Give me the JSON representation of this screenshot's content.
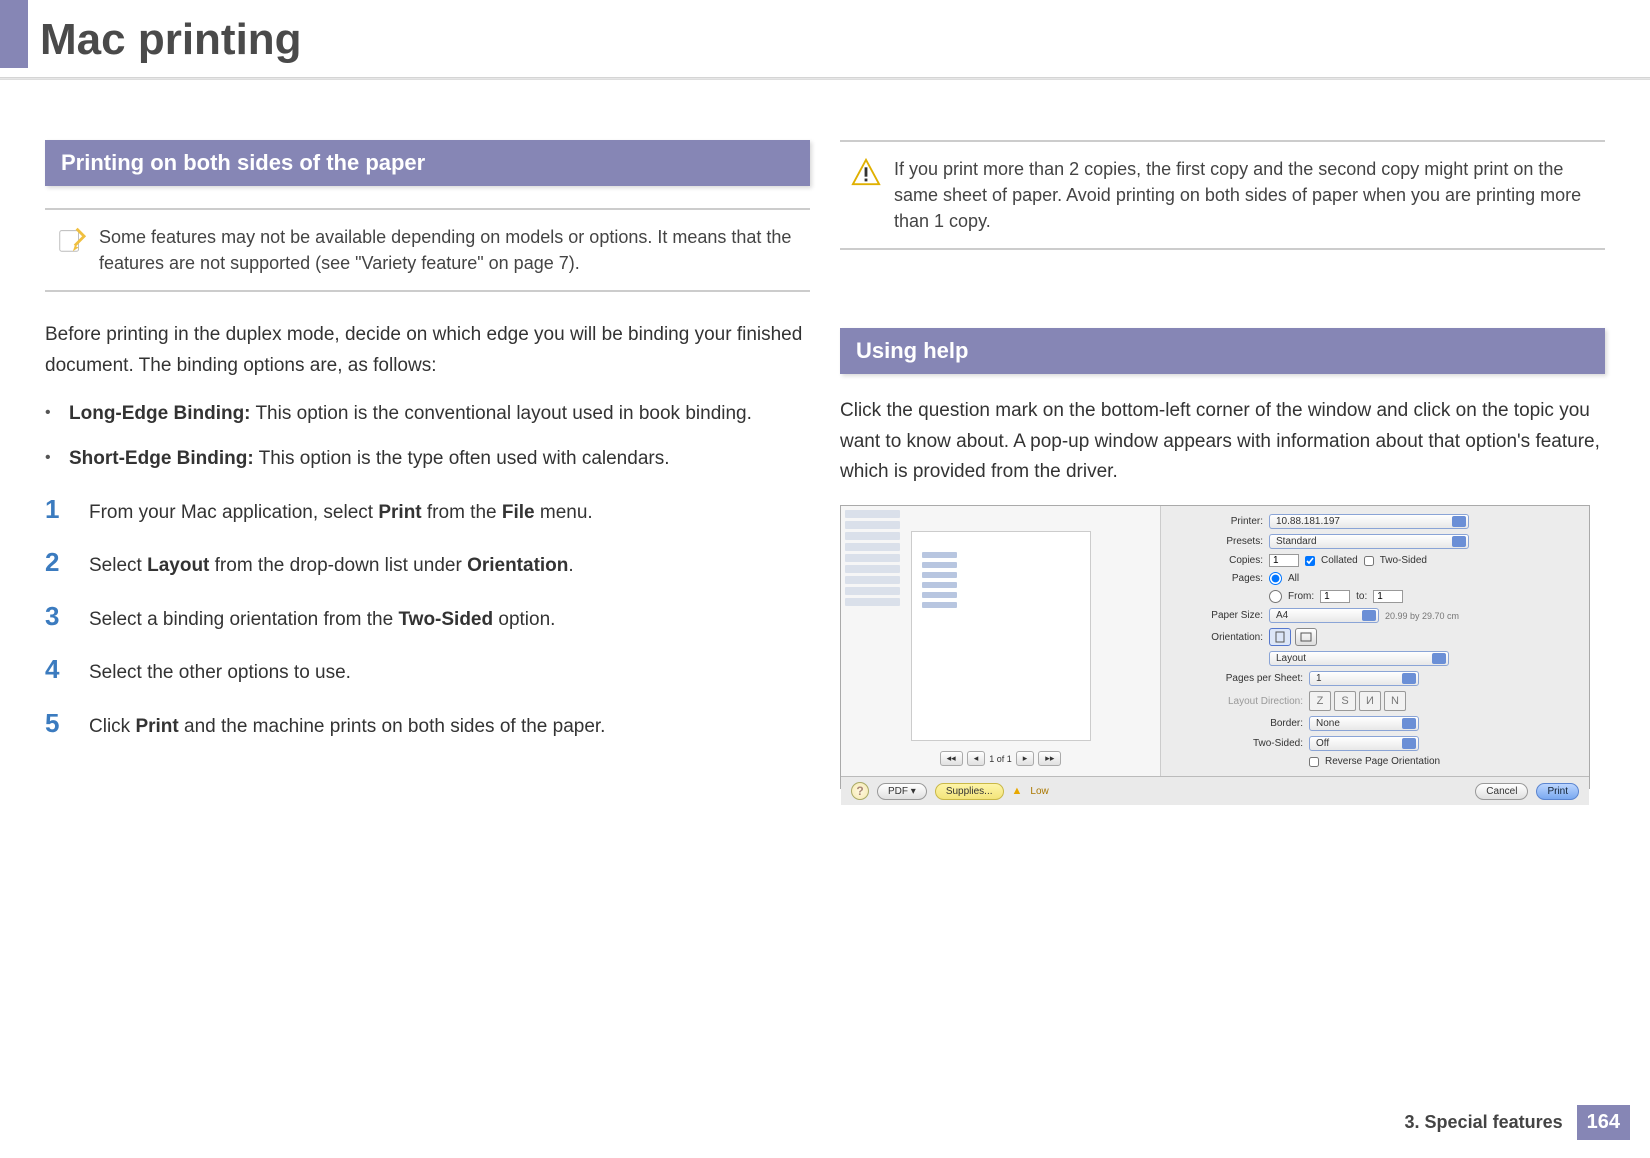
{
  "page": {
    "title": "Mac printing",
    "chapter_label": "3.  Special features",
    "page_number": "164"
  },
  "left": {
    "heading1": "Printing on both sides of the paper",
    "note1": "Some features may not be available depending on models or options. It means that the features are not supported (see \"Variety feature\" on page 7).",
    "intro": "Before printing in the duplex mode, decide on which edge you will be binding your finished document. The binding options are, as follows:",
    "bullets": [
      {
        "label": "Long-Edge Binding:",
        "desc": " This option is the conventional layout used in book binding."
      },
      {
        "label": "Short-Edge Binding:",
        "desc": " This option is the type often used with calendars."
      }
    ],
    "steps": [
      {
        "num": "1",
        "pre": "From your Mac application, select ",
        "b1": "Print",
        "mid": " from the ",
        "b2": "File",
        "post": " menu."
      },
      {
        "num": "2",
        "pre": "Select ",
        "b1": "Layout",
        "mid": " from the drop-down list under ",
        "b2": "Orientation",
        "post": "."
      },
      {
        "num": "3",
        "pre": "Select a binding orientation from the ",
        "b1": "Two-Sided",
        "mid": "",
        "b2": "",
        "post": " option."
      },
      {
        "num": "4",
        "pre": "Select the other options to use.",
        "b1": "",
        "mid": "",
        "b2": "",
        "post": ""
      },
      {
        "num": "5",
        "pre": "Click ",
        "b1": "Print",
        "mid": " and the machine prints on both sides of the paper.",
        "b2": "",
        "post": ""
      }
    ]
  },
  "right": {
    "warn": "If you print more than 2 copies, the first copy and the second copy might print on the same sheet of paper. Avoid printing on both sides of paper when you are printing more than 1 copy.",
    "heading2": "Using help",
    "help_text": "Click the question mark on the bottom-left corner of the window and click on the topic you want to know about. A pop-up window appears with information about that option's feature, which is provided from the driver."
  },
  "dialog": {
    "printer_label": "Printer:",
    "printer_value": "10.88.181.197",
    "presets_label": "Presets:",
    "presets_value": "Standard",
    "copies_label": "Copies:",
    "copies_value": "1",
    "collated": "Collated",
    "two_sided_cb": "Two-Sided",
    "pages_label": "Pages:",
    "all": "All",
    "from": "From:",
    "from_value": "1",
    "to": "to:",
    "to_value": "1",
    "paper_size_label": "Paper Size:",
    "paper_size_value": "A4",
    "paper_dim": "20.99 by 29.70 cm",
    "orientation_label": "Orientation:",
    "layout_dropdown": "Layout",
    "pps_label": "Pages per Sheet:",
    "pps_value": "1",
    "layout_dir_label": "Layout Direction:",
    "border_label": "Border:",
    "border_value": "None",
    "two_sided_label": "Two-Sided:",
    "two_sided_value": "Off",
    "reverse": "Reverse Page Orientation",
    "pager": "1 of 1",
    "help": "?",
    "pdf": "PDF ▾",
    "supplies": "Supplies...",
    "low": "Low",
    "cancel": "Cancel",
    "print": "Print"
  }
}
